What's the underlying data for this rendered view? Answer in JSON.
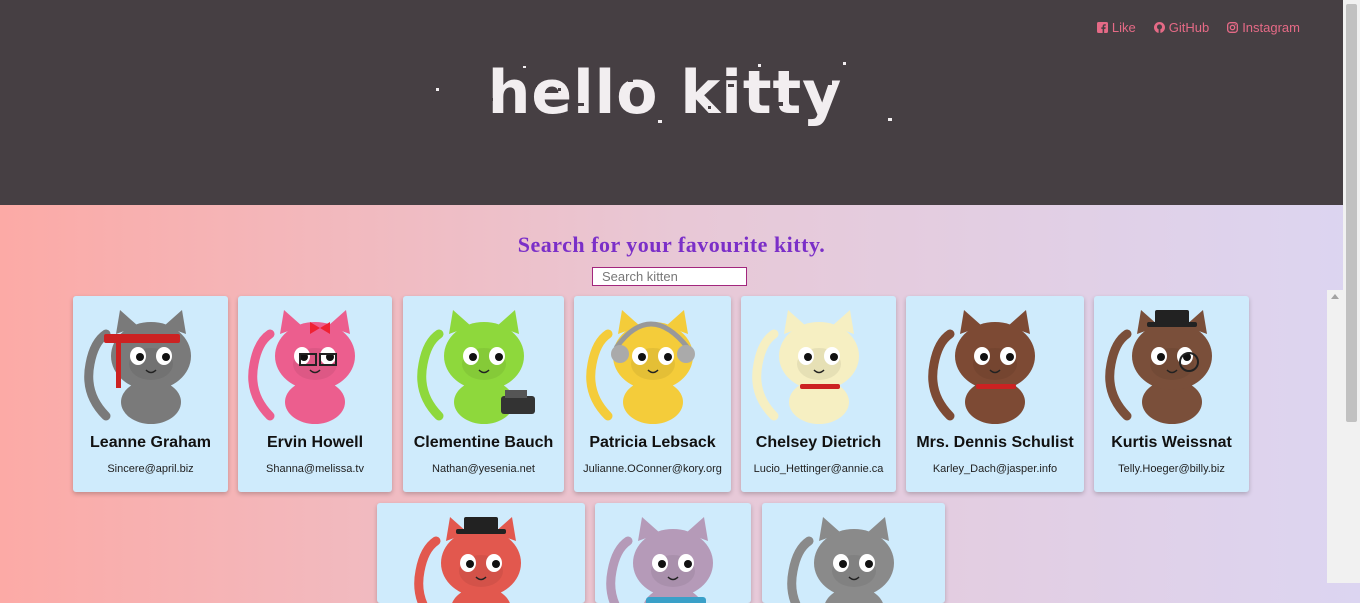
{
  "header": {
    "logo_text": "hello kitty",
    "nav": [
      {
        "label": "Like",
        "icon": "facebook-icon"
      },
      {
        "label": "GitHub",
        "icon": "github-icon"
      },
      {
        "label": "Instagram",
        "icon": "instagram-icon"
      }
    ]
  },
  "main": {
    "headline": "Search for your favourite kitty.",
    "search_placeholder": "Search kitten"
  },
  "cards": [
    {
      "name": "Leanne Graham",
      "email": "Sincere@april.biz",
      "color": "#7a7a7a"
    },
    {
      "name": "Ervin Howell",
      "email": "Shanna@melissa.tv",
      "color": "#ec5e8e"
    },
    {
      "name": "Clementine Bauch",
      "email": "Nathan@yesenia.net",
      "color": "#8ed83c"
    },
    {
      "name": "Patricia Lebsack",
      "email": "Julianne.OConner@kory.org",
      "color": "#f4cc3a"
    },
    {
      "name": "Chelsey Dietrich",
      "email": "Lucio_Hettinger@annie.ca",
      "color": "#f6efc2"
    },
    {
      "name": "Mrs. Dennis Schulist",
      "email": "Karley_Dach@jasper.info",
      "color": "#7d4a34"
    },
    {
      "name": "Kurtis Weissnat",
      "email": "Telly.Hoeger@billy.biz",
      "color": "#7a4f3a"
    },
    {
      "name": "",
      "email": "",
      "color": "#e2584e"
    },
    {
      "name": "",
      "email": "",
      "color": "#b59ab8"
    },
    {
      "name": "",
      "email": "",
      "color": "#8a8a8a"
    }
  ]
}
